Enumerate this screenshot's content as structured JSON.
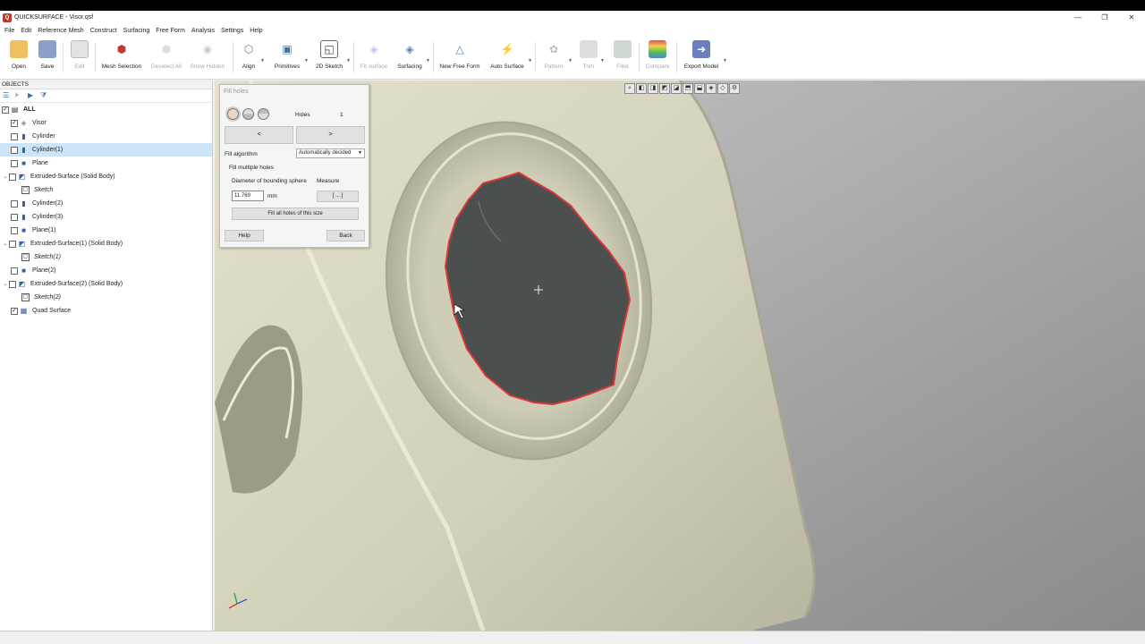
{
  "window": {
    "title": "QUICKSURFACE - Visor.qsf",
    "controls": [
      "—",
      "❐",
      "✕"
    ]
  },
  "menu": [
    "File",
    "Edit",
    "Reference Mesh",
    "Construct",
    "Surfacing",
    "Free Form",
    "Analysis",
    "Settings",
    "Help"
  ],
  "toolbar": {
    "open": "Open",
    "save": "Save",
    "edit": "Edit",
    "mesh_selection": "Mesh Selection",
    "deselect_all": "Deselect All",
    "show_hidden": "Show Hidden",
    "align": "Align",
    "primitives": "Primitives",
    "sketch_2d": "2D Sketch",
    "fit_surface": "Fit surface",
    "surfacing": "Surfacing",
    "new_free_form": "New Free Form",
    "auto_surface": "Auto Surface",
    "pattern": "Pattern",
    "trim": "Trim",
    "fillet": "Fillet",
    "compare": "Compare",
    "export_model": "Export Model"
  },
  "objects_panel": {
    "header": "OBJECTS",
    "items": [
      {
        "label": "ALL",
        "icon": "list-icon"
      },
      {
        "label": "Visor",
        "icon": "mesh-icon"
      },
      {
        "label": "Cylinder",
        "icon": "cylinder-icon"
      },
      {
        "label": "Cylinder(1)",
        "icon": "cylinder-icon"
      },
      {
        "label": "Plane",
        "icon": "plane-icon"
      },
      {
        "label": "Extruded-Surface (Solid Body)",
        "icon": "extrude-icon"
      },
      {
        "label": "Sketch",
        "icon": "sketch-icon"
      },
      {
        "label": "Cylinder(2)",
        "icon": "cylinder-icon"
      },
      {
        "label": "Cylinder(3)",
        "icon": "cylinder-icon"
      },
      {
        "label": "Plane(1)",
        "icon": "plane-icon"
      },
      {
        "label": "Extruded-Surface(1) (Solid Body)",
        "icon": "extrude-icon"
      },
      {
        "label": "Sketch(1)",
        "icon": "sketch-icon"
      },
      {
        "label": "Plane(2)",
        "icon": "plane-icon"
      },
      {
        "label": "Extruded-Surface(2) (Solid Body)",
        "icon": "extrude-icon"
      },
      {
        "label": "Sketch(2)",
        "icon": "sketch-icon"
      },
      {
        "label": "Quad Surface",
        "icon": "quad-surface-icon"
      }
    ],
    "selected": "Cylinder(1)"
  },
  "dialog": {
    "title": "Fill holes",
    "holes_label": "Holes",
    "holes_count": "1",
    "prev": "<",
    "next": ">",
    "fill_algorithm_label": "Fill algorithm",
    "fill_algorithm_value": "Automatically decided",
    "fill_multiple_label": "Fill multiple holes",
    "diameter_label": "Diameter of bounding sphere",
    "measure_label": "Measure",
    "diameter_value": "11.769",
    "unit": "mm",
    "measure_button": "[ ... ]",
    "fill_all_button": "Fill all holes of this size",
    "help_button": "Help",
    "back_button": "Back"
  },
  "colors": {
    "mesh": "#d8d6c0",
    "hole": "#4b4f4d",
    "hole_edge": "#d9383a",
    "accent": "#0078d7",
    "selection": "#cce4f7"
  }
}
